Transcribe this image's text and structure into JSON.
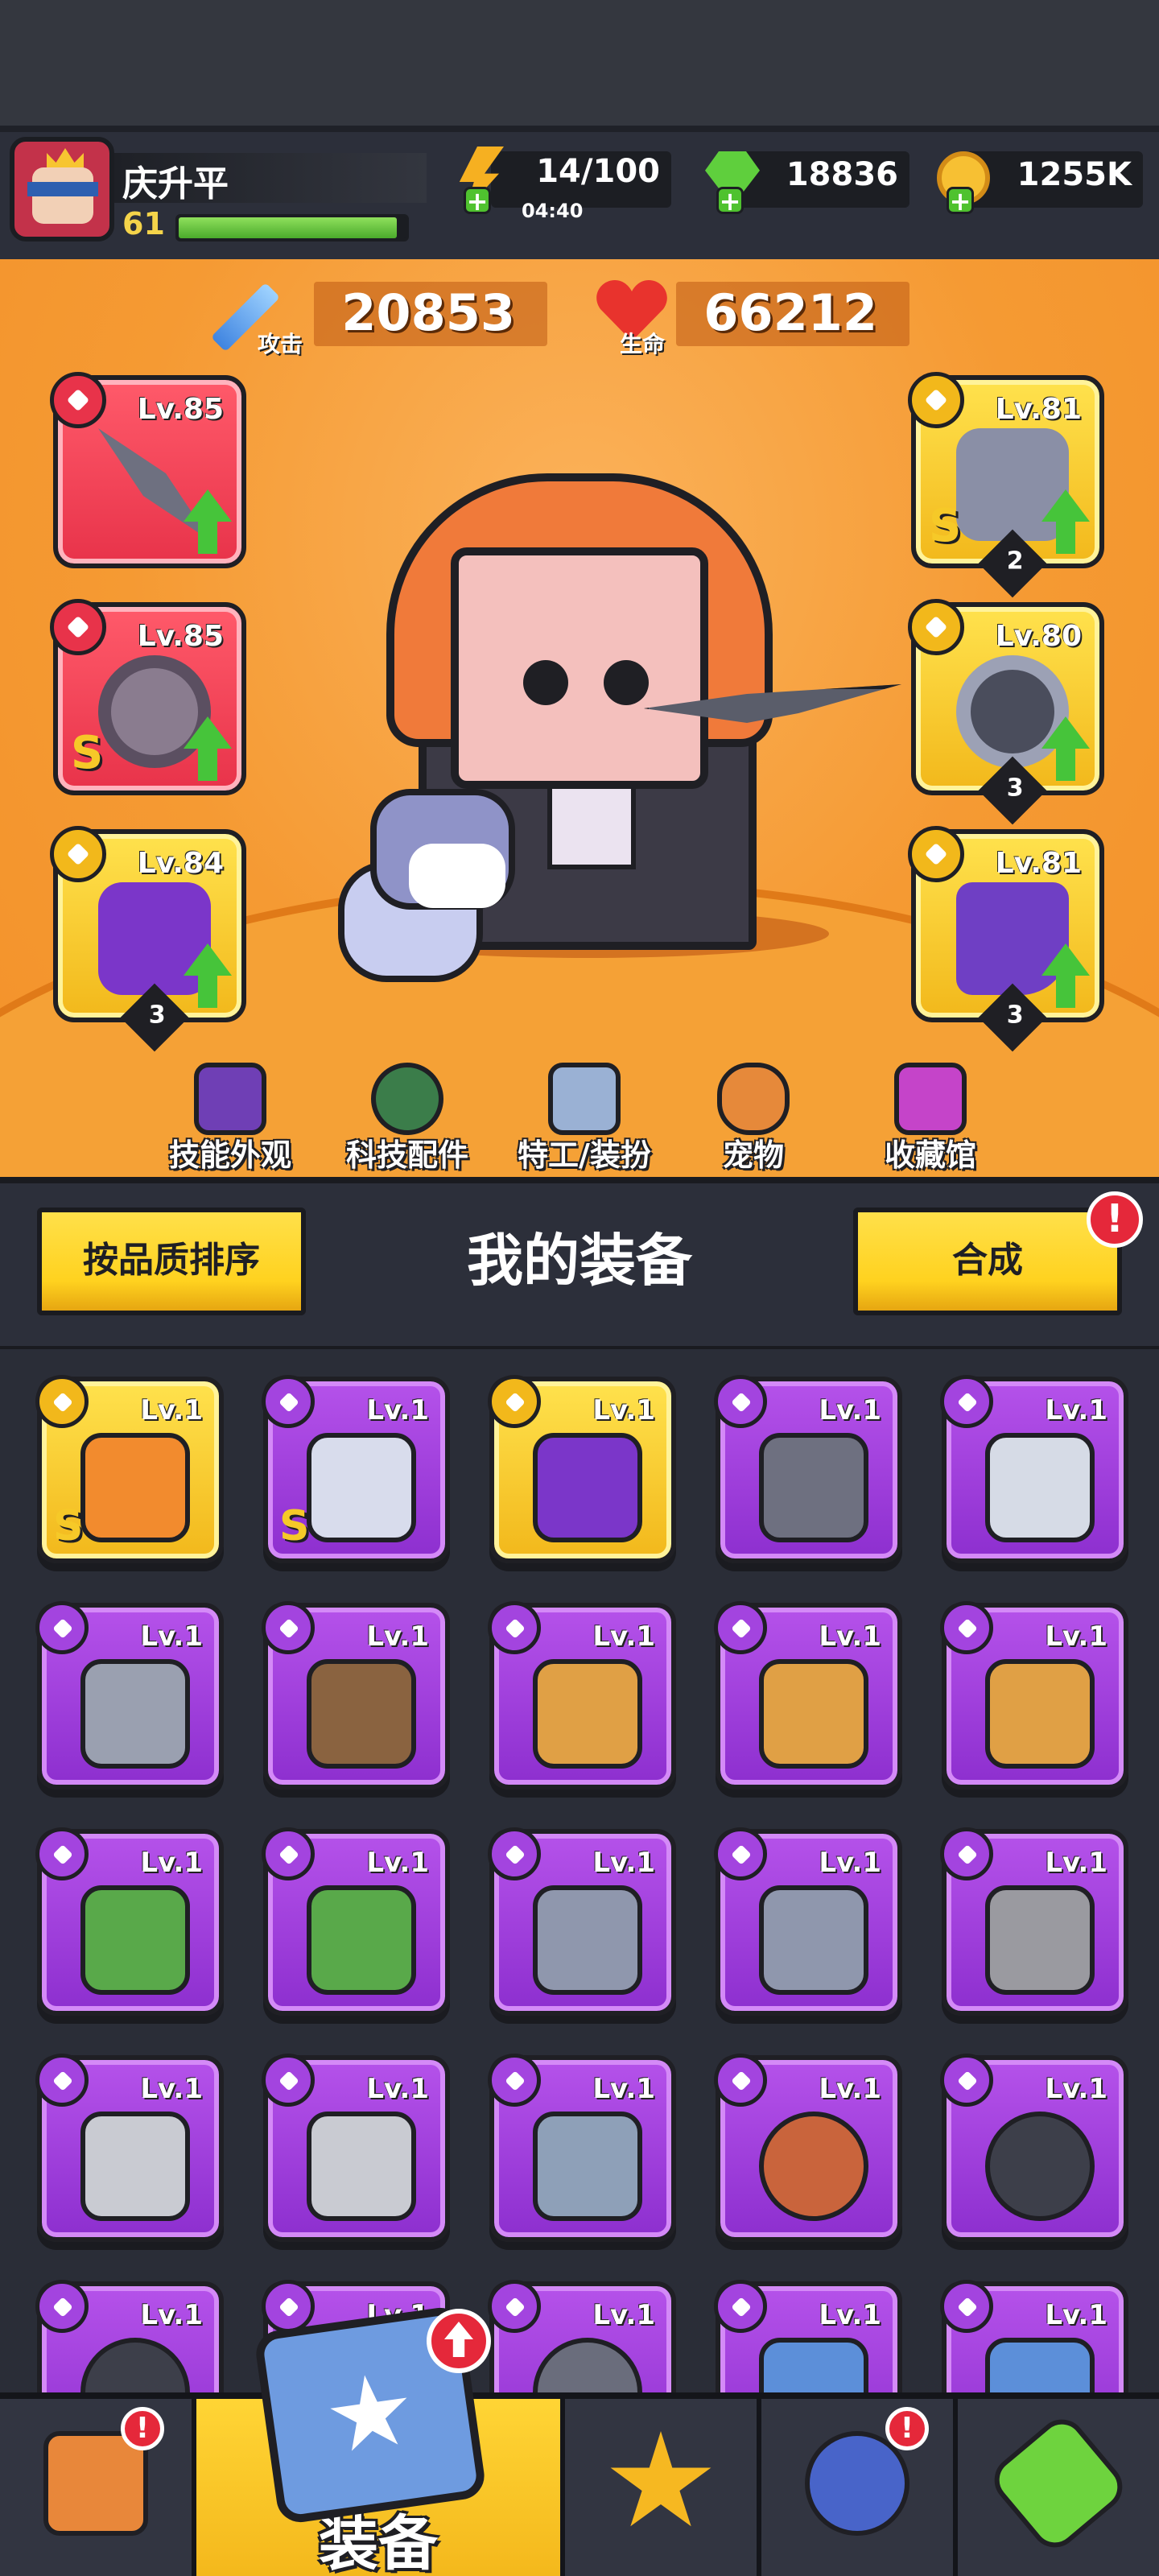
{
  "player": {
    "name": "庆升平",
    "level": "61",
    "xp_fraction": 0.96
  },
  "resources": {
    "energy": "14/100",
    "energy_timer": "04:40",
    "gems": "18836",
    "coins": "1255K"
  },
  "stats": {
    "attack_label": "攻击",
    "attack_value": "20853",
    "hp_label": "生命",
    "hp_value": "66212"
  },
  "equipped": {
    "left": [
      {
        "level": "Lv.85",
        "frame": "red",
        "icon": "kunai-icon"
      },
      {
        "level": "Lv.85",
        "frame": "red",
        "icon": "chain-necklace-icon",
        "grade": "S"
      },
      {
        "level": "Lv.84",
        "frame": "gold",
        "icon": "gauntlet-icon",
        "stars": "3"
      }
    ],
    "right": [
      {
        "level": "Lv.81",
        "frame": "gold",
        "icon": "armor-icon",
        "grade": "S",
        "stars": "2"
      },
      {
        "level": "Lv.80",
        "frame": "gold",
        "icon": "belt-icon",
        "stars": "3"
      },
      {
        "level": "Lv.81",
        "frame": "gold",
        "icon": "boots-icon",
        "stars": "3"
      }
    ]
  },
  "menu": [
    "技能外观",
    "科技配件",
    "特工/装扮",
    "宠物",
    "收藏馆"
  ],
  "panel": {
    "title": "我的装备",
    "sort_button": "按品质排序",
    "merge_button": "合成",
    "merge_alert": "!"
  },
  "inventory": [
    {
      "level": "Lv.1",
      "rarity": "gold",
      "icon": "flame-sword-icon",
      "grade": "S"
    },
    {
      "level": "Lv.1",
      "rarity": "purple",
      "icon": "blaster-icon",
      "grade": "S"
    },
    {
      "level": "Lv.1",
      "rarity": "gold",
      "icon": "gauntlet-icon"
    },
    {
      "level": "Lv.1",
      "rarity": "purple",
      "icon": "kunai-icon"
    },
    {
      "level": "Lv.1",
      "rarity": "purple",
      "icon": "katana-icon"
    },
    {
      "level": "Lv.1",
      "rarity": "purple",
      "icon": "revolver-icon"
    },
    {
      "level": "Lv.1",
      "rarity": "purple",
      "icon": "shotgun-icon"
    },
    {
      "level": "Lv.1",
      "rarity": "purple",
      "icon": "drill-spear-icon"
    },
    {
      "level": "Lv.1",
      "rarity": "purple",
      "icon": "drill-spear-icon"
    },
    {
      "level": "Lv.1",
      "rarity": "purple",
      "icon": "drill-spear-icon"
    },
    {
      "level": "Lv.1",
      "rarity": "purple",
      "icon": "green-armor-icon"
    },
    {
      "level": "Lv.1",
      "rarity": "purple",
      "icon": "green-armor-icon"
    },
    {
      "level": "Lv.1",
      "rarity": "purple",
      "icon": "steel-armor-icon"
    },
    {
      "level": "Lv.1",
      "rarity": "purple",
      "icon": "steel-armor-icon"
    },
    {
      "level": "Lv.1",
      "rarity": "purple",
      "icon": "gem-armor-icon"
    },
    {
      "level": "Lv.1",
      "rarity": "purple",
      "icon": "vest-icon"
    },
    {
      "level": "Lv.1",
      "rarity": "purple",
      "icon": "vest-icon"
    },
    {
      "level": "Lv.1",
      "rarity": "purple",
      "icon": "chest-plate-icon"
    },
    {
      "level": "Lv.1",
      "rarity": "purple",
      "icon": "fang-necklace-icon"
    },
    {
      "level": "Lv.1",
      "rarity": "purple",
      "icon": "spiked-collar-icon"
    },
    {
      "level": "Lv.1",
      "rarity": "purple",
      "icon": "spiked-collar-icon"
    },
    {
      "level": "Lv.1",
      "rarity": "purple",
      "icon": "necklace-icon"
    },
    {
      "level": "Lv.1",
      "rarity": "purple",
      "icon": "lock-necklace-icon"
    },
    {
      "level": "Lv.1",
      "rarity": "purple",
      "icon": "star-amulet-icon"
    },
    {
      "level": "Lv.1",
      "rarity": "purple",
      "icon": "star-amulet-icon"
    }
  ],
  "bottom_nav": {
    "shop_alert": "!",
    "equip_label": "装备",
    "gacha_alert": "!"
  }
}
